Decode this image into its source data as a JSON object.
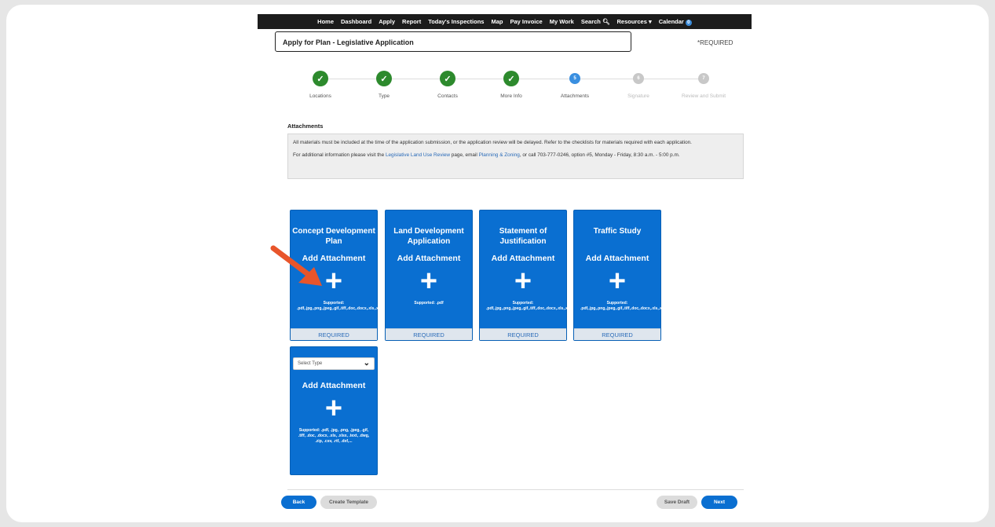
{
  "nav": {
    "items": [
      "Home",
      "Dashboard",
      "Apply",
      "Report",
      "Today's Inspections",
      "Map",
      "Pay Invoice",
      "My Work",
      "Search",
      "Resources",
      "Calendar"
    ],
    "calendar_badge": "0"
  },
  "header": {
    "title": "Apply for Plan - Legislative Application",
    "required_note": "*REQUIRED"
  },
  "steps": [
    {
      "label": "Locations",
      "status": "done"
    },
    {
      "label": "Type",
      "status": "done"
    },
    {
      "label": "Contacts",
      "status": "done"
    },
    {
      "label": "More Info",
      "status": "done"
    },
    {
      "label": "Attachments",
      "status": "current",
      "number": "5"
    },
    {
      "label": "Signature",
      "status": "todo",
      "number": "6"
    },
    {
      "label": "Review and Submit",
      "status": "todo",
      "number": "7"
    }
  ],
  "attachments": {
    "section_title": "Attachments",
    "info_line1": "All materials must be included at the time of the application submission, or the application review will be delayed. Refer to the checklists for materials required with each application.",
    "info_line2_a": "For additional information please visit the ",
    "info_link1": "Legislative Land Use Review",
    "info_line2_b": " page, email ",
    "info_link2": "Planning & Zoning",
    "info_line2_c": ", or call 703-777-0246, option #5, Monday - Friday, 8:30 a.m. - 5:00 p.m."
  },
  "cards": [
    {
      "title": "Concept Development Plan",
      "add": "Add Attachment",
      "supported": "Supported: .pdf,.jpg,.png,.jpeg,.gif,.tiff,.doc,.docx,.xls,.xlsx,.zip,.csv,.rtf,.txt",
      "required": "REQUIRED"
    },
    {
      "title": "Land Development Application",
      "add": "Add Attachment",
      "supported": "Supported: .pdf",
      "required": "REQUIRED"
    },
    {
      "title": "Statement of Justification",
      "add": "Add Attachment",
      "supported": "Supported: .pdf,.jpg,.png,.jpeg,.gif,.tiff,.doc,.docx,.xls,.xlsx,.txt",
      "required": "REQUIRED"
    },
    {
      "title": "Traffic Study",
      "add": "Add Attachment",
      "supported": "Supported: .pdf,.jpg,.png,.jpeg,.gif,.tiff,.doc,.docx,.xls,.xlsx,.txt",
      "required": "REQUIRED"
    }
  ],
  "extra_card": {
    "select_placeholder": "Select Type",
    "add": "Add Attachment",
    "supported": "Supported: .pdf, .jpg, .png, .jpeg, .gif, .tiff, .doc, .docx, .xls, .xlsx, .text, .dwg, .zip, .csv, .rtf, .dxf,..."
  },
  "footer": {
    "back": "Back",
    "create_template": "Create Template",
    "save_draft": "Save Draft",
    "next": "Next"
  },
  "colors": {
    "accent": "#0a6fd1",
    "done": "#2d8a2d",
    "annotation_arrow": "#e8552b"
  }
}
